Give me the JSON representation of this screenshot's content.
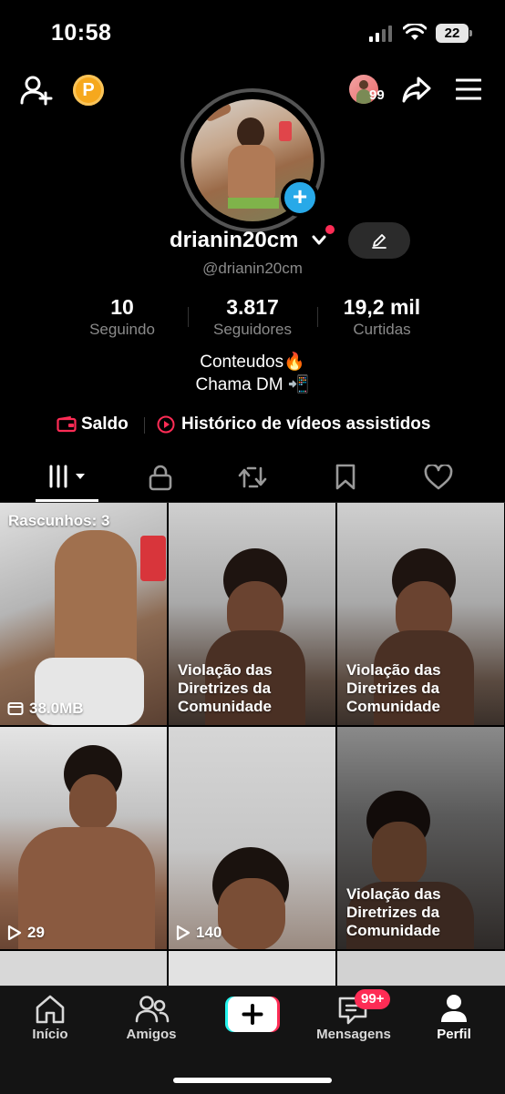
{
  "status_bar": {
    "time": "10:58",
    "battery": "22"
  },
  "top_bar": {
    "coin_label": "P",
    "notification_count": "99"
  },
  "profile": {
    "username": "drianin20cm",
    "handle": "@drianin20cm",
    "stats": [
      {
        "value": "10",
        "label": "Seguindo"
      },
      {
        "value": "3.817",
        "label": "Seguidores"
      },
      {
        "value": "19,2 mil",
        "label": "Curtidas"
      }
    ],
    "bio_line1": "Conteudos🔥",
    "bio_line2": "Chama DM 📲",
    "links": {
      "balance": "Saldo",
      "history": "Histórico de vídeos assistidos"
    }
  },
  "tabs": [
    "videos-grid-icon",
    "lock-icon",
    "repost-icon",
    "bookmark-icon",
    "heart-icon"
  ],
  "grid": {
    "cells": [
      {
        "top_label": "Rascunhos: 3",
        "bottom_label": "38.0MB"
      },
      {
        "violation": [
          "Violação das",
          "Diretrizes da",
          "Comunidade"
        ]
      },
      {
        "violation": [
          "Violação das",
          "Diretrizes da",
          "Comunidade"
        ]
      },
      {
        "views": "29"
      },
      {
        "views": "140"
      },
      {
        "violation": [
          "Violação das",
          "Diretrizes da",
          "Comunidade"
        ]
      }
    ]
  },
  "bottom_nav": {
    "items": [
      {
        "label": "Início"
      },
      {
        "label": "Amigos"
      },
      {
        "label": ""
      },
      {
        "label": "Mensagens",
        "badge": "99+"
      },
      {
        "label": "Perfil"
      }
    ]
  },
  "colors": {
    "accent_red": "#fe2c55",
    "accent_blue": "#28a9e8",
    "coin": "#f6a81d"
  }
}
